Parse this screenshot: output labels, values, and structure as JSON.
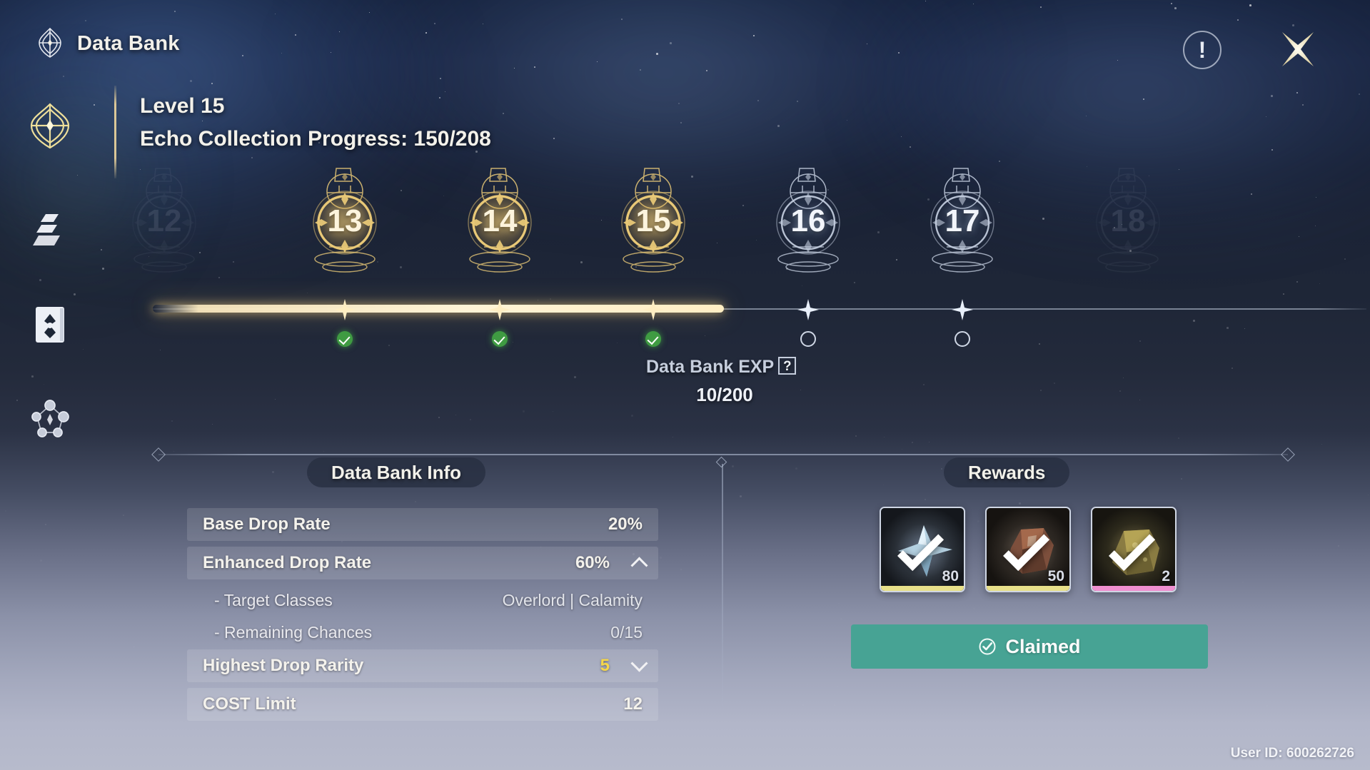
{
  "window": {
    "title": "Data Bank",
    "logo_icon": "data-bank-emblem-icon",
    "info_icon": "exclamation-circle-icon",
    "close_icon": "four-point-star-close-icon",
    "user_id": "User ID: 600262726"
  },
  "sidebar": {
    "items": [
      {
        "name": "data-bank",
        "icon": "data-bank-emblem-icon",
        "active": true
      },
      {
        "name": "echo-fusion",
        "icon": "echo-fusion-icon",
        "active": false
      },
      {
        "name": "echo-catalog",
        "icon": "echo-catalog-book-icon",
        "active": false
      },
      {
        "name": "echo-network",
        "icon": "echo-network-nodes-icon",
        "active": false
      }
    ]
  },
  "header": {
    "level": "Level 15",
    "progress": "Echo Collection Progress: 150/208"
  },
  "track": {
    "nodes": [
      {
        "label": "12",
        "state": "ghost",
        "marker": "none"
      },
      {
        "label": "13",
        "state": "done",
        "marker": "ok"
      },
      {
        "label": "14",
        "state": "done",
        "marker": "ok"
      },
      {
        "label": "15",
        "state": "done",
        "marker": "ok",
        "current": true
      },
      {
        "label": "16",
        "state": "lock",
        "marker": "pending"
      },
      {
        "label": "17",
        "state": "lock",
        "marker": "pending"
      },
      {
        "label": "18",
        "state": "ghost",
        "marker": "none"
      }
    ],
    "exp_label": "Data Bank EXP",
    "exp_help": "?",
    "exp_value": "10/200"
  },
  "info_section": {
    "title": "Data Bank Info",
    "rows": [
      {
        "key": "Base Drop Rate",
        "value": "20%",
        "style": "shade",
        "chevron": "none"
      },
      {
        "key": "Enhanced Drop Rate",
        "value": "60%",
        "style": "shade",
        "chevron": "up"
      },
      {
        "key": "- Target Classes",
        "value": "Overlord | Calamity",
        "style": "sub",
        "chevron": "none"
      },
      {
        "key": "- Remaining Chances",
        "value": "0/15",
        "style": "sub",
        "chevron": "none"
      },
      {
        "key": "Highest Drop Rarity",
        "value": "5",
        "style": "shade",
        "chevron": "down",
        "value_color": "gold"
      },
      {
        "key": "COST Limit",
        "value": "12",
        "style": "shade",
        "chevron": "none"
      }
    ]
  },
  "rewards_section": {
    "title": "Rewards",
    "cards": [
      {
        "name": "shell-credit-item",
        "qty": "80",
        "rarity_color": "#e8e08a",
        "art": "blue-crystal-shard"
      },
      {
        "name": "echo-material-item",
        "qty": "50",
        "rarity_color": "#e8e08a",
        "art": "brown-ore-chunk"
      },
      {
        "name": "premium-echo-item",
        "qty": "2",
        "rarity_color": "#f08fd0",
        "art": "gold-rock-chunk"
      }
    ],
    "claim_button": {
      "label": "Claimed",
      "icon": "check-circle-icon",
      "color": "#47a394",
      "disabled": true
    }
  },
  "colors": {
    "gold": "#f0d48a",
    "teal": "#47a394",
    "green_check": "#3f9b42",
    "highlight_gold_text": "#f5d64a"
  }
}
